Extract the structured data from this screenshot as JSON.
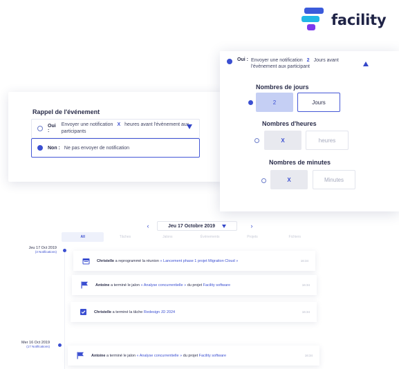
{
  "brand": {
    "name": "facility"
  },
  "reminder": {
    "title": "Rappel de l'événement",
    "yes_label": "Oui :",
    "yes_text_before": "Envoyer une notification",
    "yes_value": "X",
    "yes_text_after": "heures avant l'évènement aux participants",
    "no_label": "Non :",
    "no_text": "Ne pas envoyer de notification"
  },
  "settings": {
    "head_label": "Oui :",
    "head_text_before": "Envoyer une notification",
    "head_value": "2",
    "head_text_after": "Jours avant l'évènement aux participant",
    "days_title": "Nombres de jours",
    "days_value": "2",
    "days_unit": "Jours",
    "hours_title": "Nombres d'heures",
    "hours_value": "X",
    "hours_unit": "heures",
    "minutes_title": "Nombres de minutes",
    "minutes_value": "X",
    "minutes_unit": "Minutes"
  },
  "timeline": {
    "date_selected": "Jeu 17 Octobre 2019",
    "filters": [
      {
        "label": "All",
        "active": true
      },
      {
        "label": "Tâches",
        "active": false
      },
      {
        "label": "Jalons",
        "active": false
      },
      {
        "label": "Événements",
        "active": false
      },
      {
        "label": "Projets",
        "active": false
      },
      {
        "label": "Fichiers",
        "active": false
      }
    ],
    "days": [
      {
        "date": "Jeu 17 Oct 2019",
        "count": "(3 Notifications)"
      },
      {
        "date": "Mer 16 Oct 2019",
        "count": "(17 Notifications)"
      }
    ],
    "events": [
      {
        "actor": "Christelle",
        "action": "a reprogrammé la réunion",
        "target": "« Lancement phase 1 projet Migration Cloud »",
        "suffix": "",
        "project": "",
        "time": "16:34"
      },
      {
        "actor": "Antoine",
        "action": "a terminé le jalon",
        "target": "« Analyse concurrentielle »",
        "suffix": "du projet",
        "project": "Facility software",
        "time": "16:34"
      },
      {
        "actor": "Christelle",
        "action": "a terminé la tâche",
        "target": "Redesign JD 2024",
        "suffix": "",
        "project": "",
        "time": "16:34"
      },
      {
        "actor": "Antoine",
        "action": "a terminé le jalon",
        "target": "« Analyse concurrentielle »",
        "suffix": "du projet",
        "project": "Facility software",
        "time": "16:34"
      }
    ]
  },
  "colors": {
    "accent": "#3b4fd1",
    "brand_blue": "#3b5bdb",
    "brand_cyan": "#22b8e6",
    "brand_violet": "#7c3aed"
  }
}
